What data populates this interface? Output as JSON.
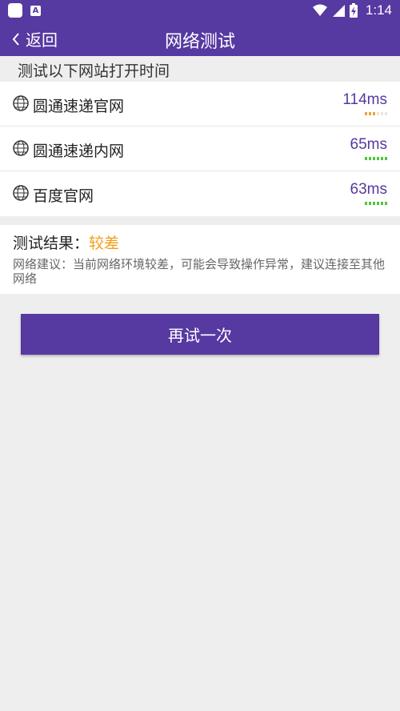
{
  "status_bar": {
    "time": "1:14"
  },
  "header": {
    "back_label": "返回",
    "title": "网络测试"
  },
  "section_label": "测试以下网站打开时间",
  "sites": [
    {
      "name": "圆通速递官网",
      "latency": "114ms",
      "signal_level": 3,
      "signal_max": 6,
      "signal_color": "#f0a33b"
    },
    {
      "name": "圆通速递内网",
      "latency": "65ms",
      "signal_level": 6,
      "signal_max": 6,
      "signal_color": "#4cc837"
    },
    {
      "name": "百度官网",
      "latency": "63ms",
      "signal_level": 6,
      "signal_max": 6,
      "signal_color": "#4cc837"
    }
  ],
  "result": {
    "label": "测试结果：",
    "value": "较差",
    "advice": "网络建议：当前网络环境较差，可能会导致操作异常，建议连接至其他网络"
  },
  "retry_button": "再试一次",
  "colors": {
    "primary": "#5639a1",
    "warning": "#f29e16",
    "good": "#4cc837"
  },
  "icons": {
    "site_icon": "globe-icon",
    "back_icon": "chevron-left-icon"
  }
}
